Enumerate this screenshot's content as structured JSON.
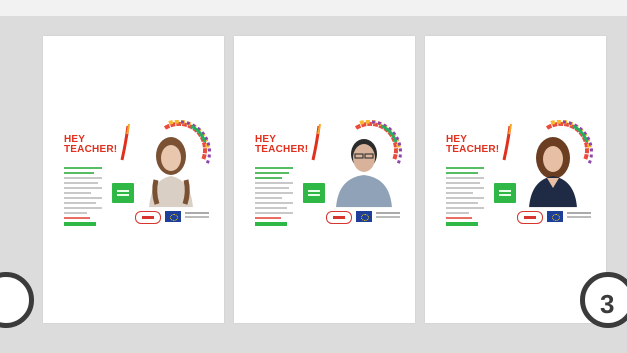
{
  "viewer": {
    "pages": [
      {
        "heading_line1": "HEY",
        "heading_line2": "TEACHER!",
        "person": "young-woman"
      },
      {
        "heading_line1": "HEY",
        "heading_line2": "TEACHER!",
        "person": "young-man"
      },
      {
        "heading_line1": "HEY",
        "heading_line2": "TEACHER!",
        "person": "woman"
      }
    ],
    "nav_right_label": "3"
  },
  "colors": {
    "background": "#dcdcdc",
    "heading_red": "#e0301e",
    "accent_green": "#2fb845",
    "eu_blue": "#1e3f99",
    "nav_ring": "#3b3b3b"
  },
  "icons": [
    "rainbow-arc-icon",
    "eu-flag-icon",
    "partner-logo-icon"
  ]
}
